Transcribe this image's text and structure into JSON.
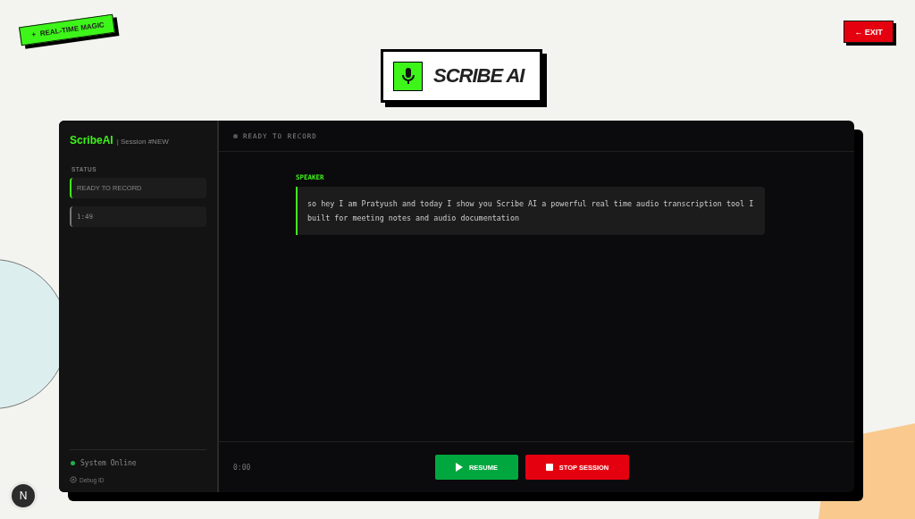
{
  "badge": {
    "icon": "+",
    "label": "REAL-TIME MAGIC"
  },
  "exit_button": {
    "label": "← EXIT"
  },
  "logo": {
    "title": "SCRIBE AI"
  },
  "sidebar": {
    "brand": "ScribeAI",
    "session": "| Session #NEW",
    "status_heading": "STATUS",
    "status_items": [
      {
        "text": "READY TO RECORD",
        "active": true
      },
      {
        "text": "1:49",
        "active": false
      }
    ],
    "system_status": {
      "text": "System Online",
      "online": true
    },
    "debug": "Debug ID"
  },
  "header": {
    "status": "READY TO RECORD"
  },
  "transcript": [
    {
      "speaker": "SPEAKER",
      "text": "so hey I am Pratyush and today I show you Scribe AI a powerful real time audio transcription tool I built for meeting notes and audio documentation"
    }
  ],
  "footer": {
    "timer": "0:00",
    "buttons": [
      {
        "kind": "resume",
        "label": "RESUME"
      },
      {
        "kind": "stop",
        "label": "STOP SESSION"
      }
    ]
  },
  "dev_badge": {
    "letter": "N"
  }
}
